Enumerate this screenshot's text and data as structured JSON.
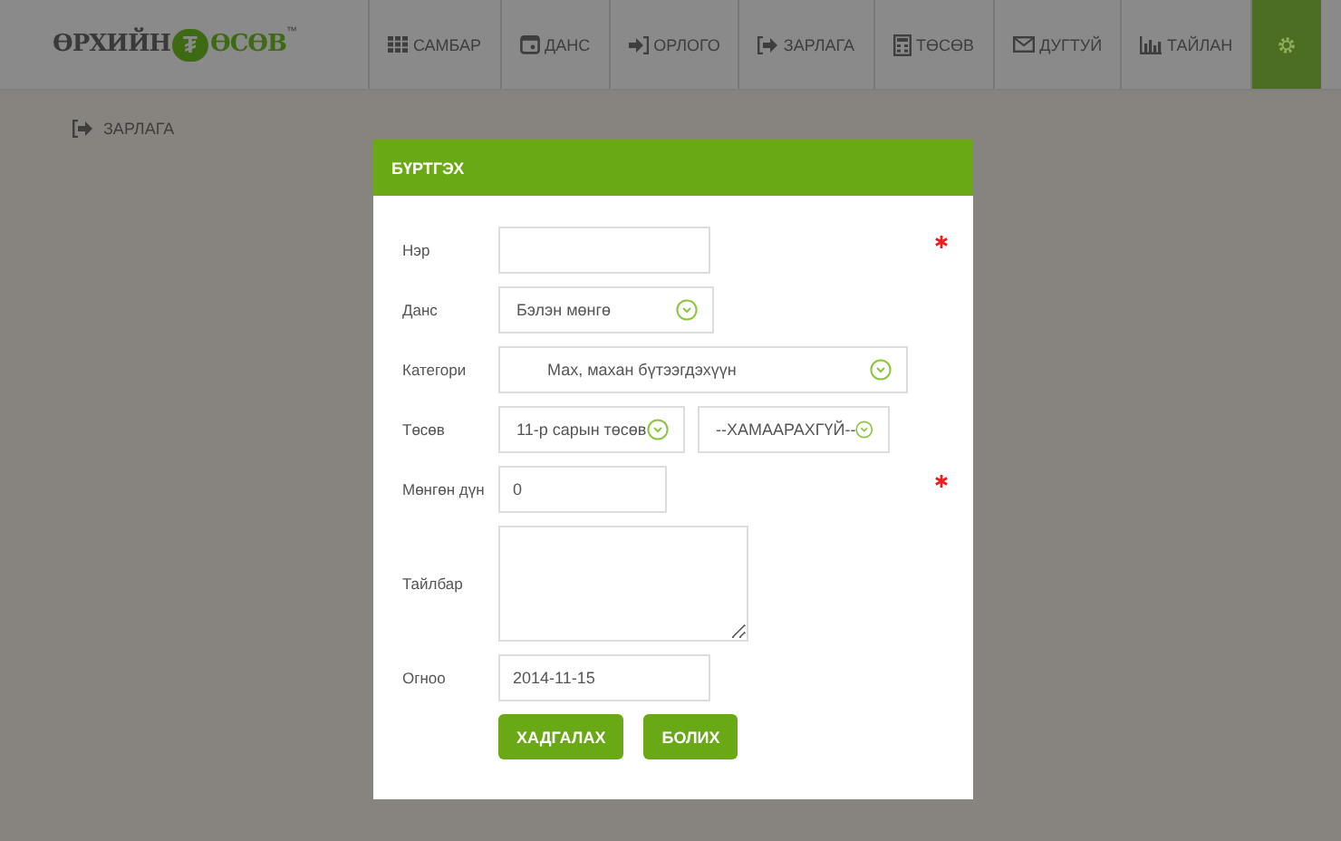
{
  "logo": {
    "left": "ӨРХИЙН",
    "symbol": "₮",
    "right": "ӨСӨВ",
    "trademark": "™"
  },
  "nav": [
    {
      "kind": "grid",
      "label": "САМБАР",
      "selected": false
    },
    {
      "kind": "wallet",
      "label": "ДАНС",
      "selected": false
    },
    {
      "kind": "signin",
      "label": "ОРЛОГО",
      "selected": false
    },
    {
      "kind": "signout",
      "label": "ЗАРЛАГА",
      "selected": false
    },
    {
      "kind": "calc",
      "label": "ТӨСӨВ",
      "selected": false
    },
    {
      "kind": "mail",
      "label": "ДУГТУЙ",
      "selected": false
    },
    {
      "kind": "chart",
      "label": "ТАЙЛАН",
      "selected": false
    },
    {
      "kind": "gear",
      "selected": true
    }
  ],
  "breadcrumb": "ЗАРЛАГА",
  "modal": {
    "title": "БҮРТГЭХ",
    "fields": [
      {
        "kind": "text",
        "label": "Нэр",
        "required": true
      },
      {
        "kind": "select",
        "label": "Данс",
        "value": "Бэлэн мөнгө",
        "required": false
      },
      {
        "kind": "select_wide",
        "label": "Категори",
        "value": "Мах, махан бүтээгдэхүүн",
        "required": false
      },
      {
        "kind": "select_pair",
        "label": "Төсөв",
        "value": "11-р сарын төсөв",
        "value_2": "--ХАМААРАХГҮЙ--",
        "required": false
      },
      {
        "kind": "number",
        "label": "Мөнгөн дүн",
        "value": "0",
        "required": true
      },
      {
        "kind": "textarea",
        "label": "Тайлбар",
        "required": false
      },
      {
        "kind": "date",
        "label": "Огноо",
        "value": "2014-11-15",
        "required": false
      }
    ],
    "buttons": [
      "ХАДГАЛАХ",
      "БОЛИХ"
    ]
  }
}
